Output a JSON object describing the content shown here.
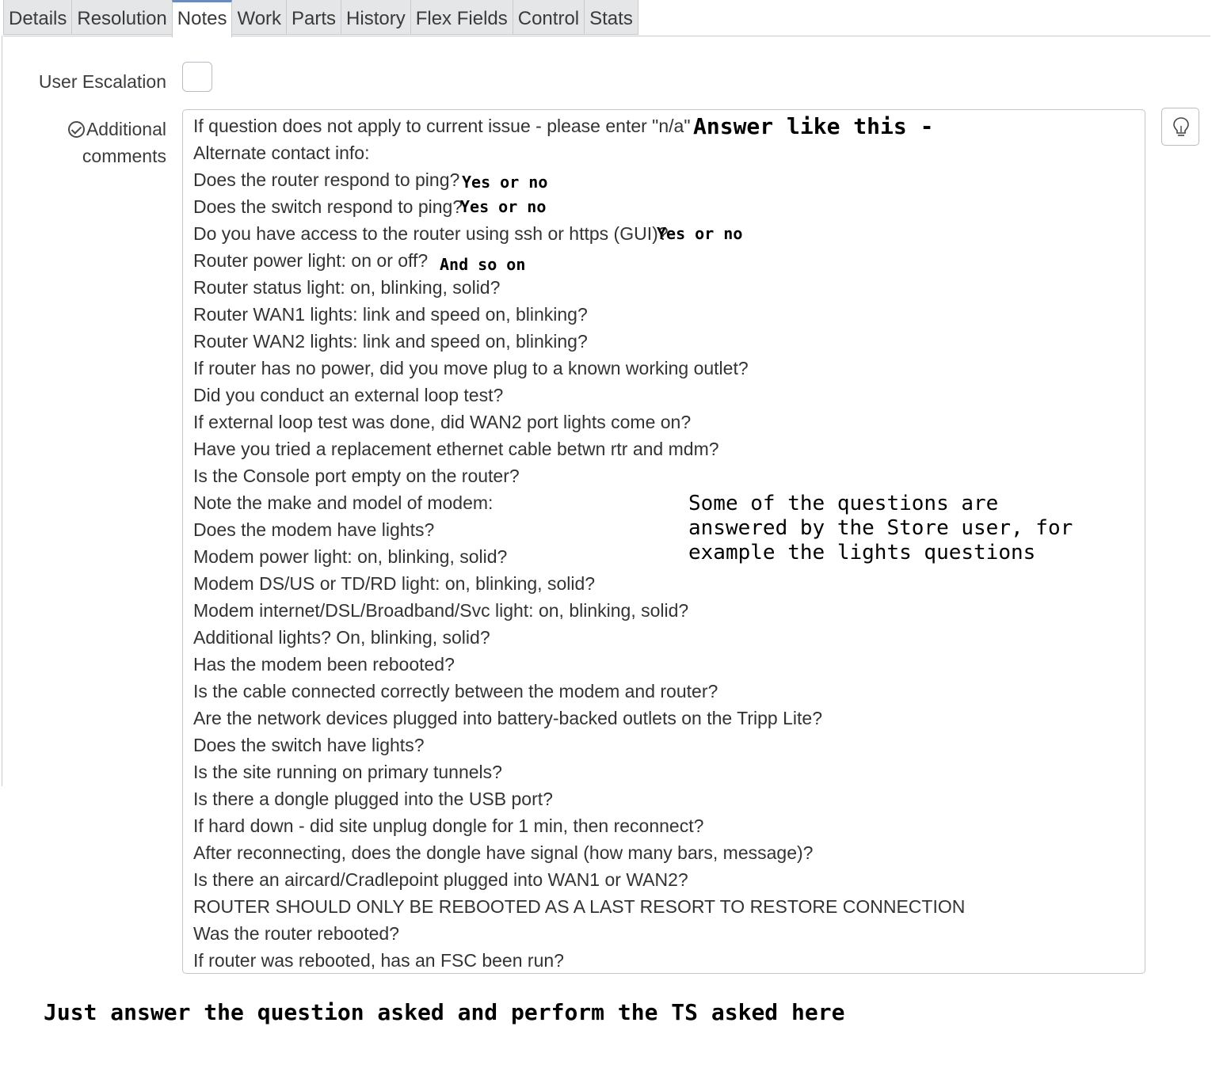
{
  "tabs": [
    {
      "label": "Details",
      "active": false
    },
    {
      "label": "Resolution",
      "active": false
    },
    {
      "label": "Notes",
      "active": true
    },
    {
      "label": "Work",
      "active": false
    },
    {
      "label": "Parts",
      "active": false
    },
    {
      "label": "History",
      "active": false
    },
    {
      "label": "Flex Fields",
      "active": false
    },
    {
      "label": "Control",
      "active": false
    },
    {
      "label": "Stats",
      "active": false
    }
  ],
  "form": {
    "user_escalation_label": "User Escalation",
    "user_escalation_checked": false,
    "additional_comments_label_1": "Additional",
    "additional_comments_label_2": "comments",
    "comment_lines": [
      "If question does not apply to current issue - please enter \"n/a\"",
      "Alternate contact info:",
      "Does the router respond to ping?",
      "Does the switch respond to ping?",
      "Do you have access to the router using ssh or https (GUI)?",
      "Router power light: on or off?",
      "Router status light: on, blinking, solid?",
      "Router WAN1 lights: link and speed on, blinking?",
      "Router WAN2 lights: link and speed on, blinking?",
      "If router has no power, did you move plug to a known working outlet?",
      "Did you conduct an external loop test?",
      "If external loop test was done, did WAN2 port lights come on?",
      "Have you tried a replacement ethernet cable betwn rtr and mdm?",
      "Is the Console port empty on the router?",
      "Note the make and model of modem:",
      "Does the modem have lights?",
      "Modem power light: on, blinking, solid?",
      "Modem DS/US or TD/RD light: on, blinking, solid?",
      "Modem internet/DSL/Broadband/Svc light: on, blinking, solid?",
      "Additional lights? On, blinking, solid?",
      "Has the modem been rebooted?",
      "Is the cable connected correctly between the modem and router?",
      "Are the network devices plugged into battery-backed outlets on the Tripp Lite?",
      "Does the switch have lights?",
      "Is the site running on primary tunnels?",
      "Is there a dongle plugged into the USB port?",
      "If hard down - did site unplug dongle for 1 min, then reconnect?",
      "After reconnecting, does the dongle have signal (how many bars, message)?",
      "Is there an aircard/Cradlepoint plugged into WAN1 or WAN2?",
      "ROUTER SHOULD ONLY BE REBOOTED AS A LAST RESORT TO RESTORE CONNECTION",
      "Was the router rebooted?",
      "If router was rebooted, has an FSC been run?"
    ],
    "suggestion_icon": "lightbulb-icon"
  },
  "annotations": {
    "answer_like_this": "Answer like this -",
    "yes_or_no_1": "Yes or no",
    "yes_or_no_2": "Yes or no",
    "yes_or_no_3": "Yes or no",
    "and_so_on": "And so on",
    "store_user_note": "Some of the questions are\nanswered by the Store user, for\nexample the lights questions",
    "bottom_note": "Just answer the question asked and perform the TS asked here"
  },
  "colors": {
    "active_tab_accent": "#6b8cb8",
    "tab_background": "#e4e6e8",
    "border": "#c7cbcf"
  }
}
